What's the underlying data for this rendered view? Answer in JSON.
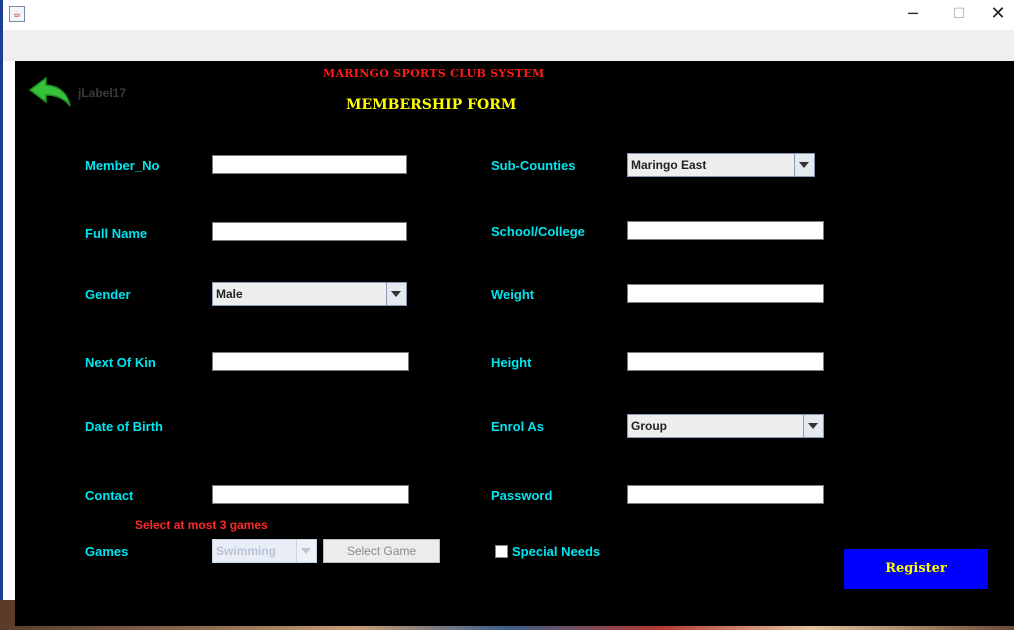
{
  "window": {
    "min": "─",
    "max": "☐",
    "close": "✕"
  },
  "header": {
    "jlabel": "jLabel17",
    "system_title": "MARINGO SPORTS CLUB SYSTEM",
    "form_title": "MEMBERSHIP FORM"
  },
  "form": {
    "member_no": {
      "label": "Member_No",
      "value": ""
    },
    "full_name": {
      "label": "Full Name",
      "value": ""
    },
    "gender": {
      "label": "Gender",
      "value": "Male"
    },
    "next_of_kin": {
      "label": "Next Of Kin",
      "value": ""
    },
    "date_of_birth": {
      "label": "Date of Birth"
    },
    "contact": {
      "label": "Contact",
      "value": ""
    },
    "games": {
      "label": "Games",
      "value": "Swimming",
      "warning": "Select at most 3 games",
      "select_button": "Select Game"
    },
    "sub_counties": {
      "label": "Sub-Counties",
      "value": "Maringo East"
    },
    "school": {
      "label": "School/College",
      "value": ""
    },
    "weight": {
      "label": "Weight",
      "value": ""
    },
    "height": {
      "label": "Height",
      "value": ""
    },
    "enrol_as": {
      "label": "Enrol As",
      "value": "Group"
    },
    "password": {
      "label": "Password",
      "value": ""
    },
    "special_needs": {
      "label": "Special Needs",
      "checked": false
    },
    "register_button": "Register"
  },
  "colors": {
    "panel": "#000000",
    "label": "#00e5ee",
    "title": "#ff1a1a",
    "form_title": "#ffff00",
    "register_bg": "#0000ff",
    "warning": "#ff2a2a"
  },
  "icons": {
    "back": "back-arrow-icon",
    "app": "java-app-icon"
  }
}
